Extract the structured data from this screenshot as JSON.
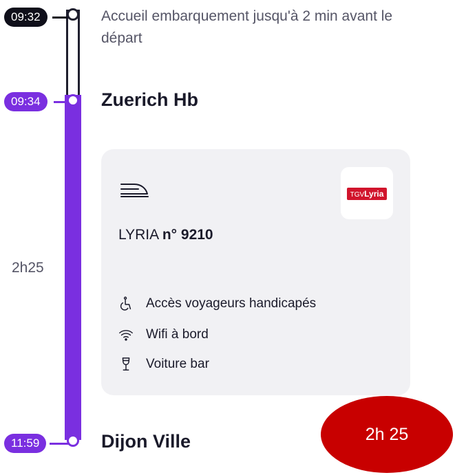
{
  "timeline": {
    "boarding_time": "09:32",
    "boarding_text": "Accueil embarquement jusqu'à 2 min avant le départ",
    "departure_time": "09:34",
    "departure_station": "Zuerich Hb",
    "duration": "2h25",
    "arrival_time": "11:59",
    "arrival_station": "Dijon Ville"
  },
  "train": {
    "icon": "train-icon",
    "name_prefix": "LYRIA",
    "name_number": "n° 9210",
    "logo_tgv": "TGV",
    "logo_lyria": "Lyria"
  },
  "services": [
    {
      "icon": "wheelchair-icon",
      "label": "Accès voyageurs handicapés"
    },
    {
      "icon": "wifi-icon",
      "label": "Wifi à bord"
    },
    {
      "icon": "wine-glass-icon",
      "label": "Voiture bar"
    }
  ],
  "overlay_badge": "2h 25",
  "colors": {
    "accent": "#7a2fe0",
    "dark": "#0f0f1a",
    "card_bg": "#f1f1f4",
    "logo_red": "#d1142c",
    "badge_red": "#c80000"
  }
}
